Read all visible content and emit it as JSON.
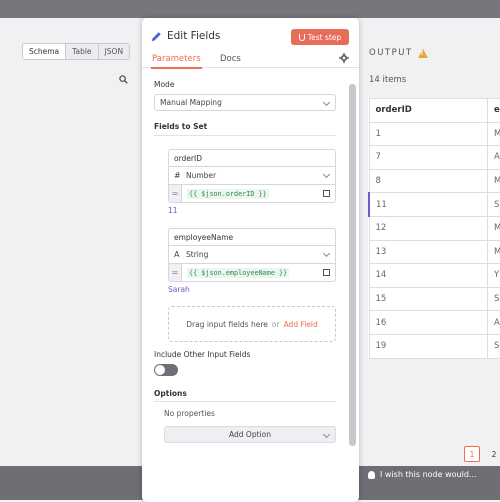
{
  "input_panel": {
    "view_tabs": [
      {
        "label": "Schema",
        "active": true
      },
      {
        "label": "Table",
        "active": false
      },
      {
        "label": "JSON",
        "active": false
      }
    ],
    "search_icon": "search-icon"
  },
  "modal": {
    "title": "Edit Fields",
    "test_step_label": "Test step",
    "tabs": [
      {
        "label": "Parameters",
        "active": true
      },
      {
        "label": "Docs",
        "active": false
      }
    ],
    "mode_label": "Mode",
    "mode_value": "Manual Mapping",
    "fields_label": "Fields to Set",
    "fields": [
      {
        "name": "orderID",
        "type_glyph": "#",
        "type": "Number",
        "expression": "{{ $json.orderID }}",
        "result": "11"
      },
      {
        "name": "employeeName",
        "type_glyph": "A",
        "type": "String",
        "expression": "{{ $json.employeeName }}",
        "result": "Sarah"
      }
    ],
    "drop_text": "Drag input fields here",
    "drop_or": "or",
    "add_field_label": "Add Field",
    "include_other_label": "Include Other Input Fields",
    "include_other_enabled": false,
    "options_label": "Options",
    "no_properties": "No properties",
    "add_option_label": "Add Option"
  },
  "output": {
    "title": "OUTPUT",
    "count": "14 items",
    "columns": [
      "orderID",
      "e"
    ],
    "rows": [
      [
        "1",
        "M"
      ],
      [
        "7",
        "A"
      ],
      [
        "8",
        "M"
      ],
      [
        "11",
        "S"
      ],
      [
        "12",
        "M"
      ],
      [
        "13",
        "M"
      ],
      [
        "14",
        "Y"
      ],
      [
        "15",
        "S"
      ],
      [
        "16",
        "A"
      ],
      [
        "19",
        "S"
      ]
    ],
    "highlighted_row": 3,
    "pages": [
      {
        "label": "1",
        "active": true
      },
      {
        "label": "2",
        "active": false
      }
    ]
  },
  "footer": {
    "hint": "I wish this node would..."
  },
  "colors": {
    "accent": "#ef6c4d",
    "button": "#e86c5a",
    "expression_text": "#2e8b57",
    "result_text": "#6a5acd",
    "warning": "#e8a534"
  }
}
